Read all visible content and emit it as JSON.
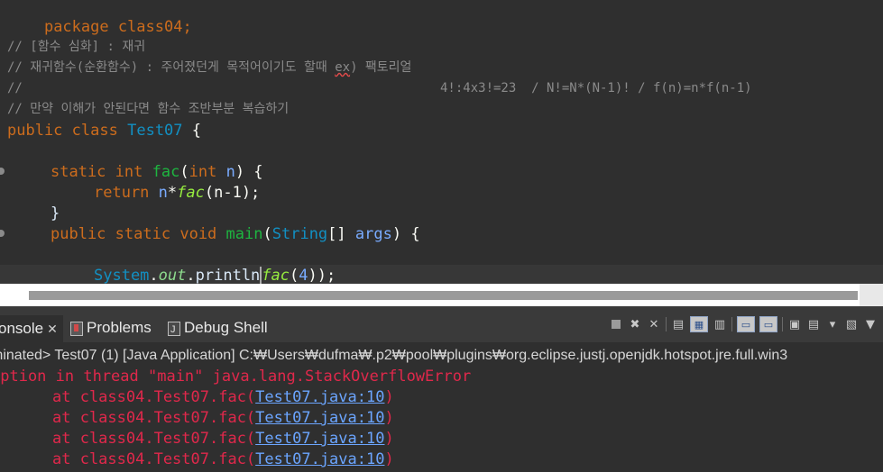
{
  "editor": {
    "line_package": "package class04;",
    "comment1": "// [함수 심화] : 재귀",
    "comment2_a": "// 재귀함수(순환함수) : 주어졌던게 목적어이기도 할때 ",
    "comment2_ex": "ex",
    "comment2_b": ") 팩토리얼",
    "comment3_a": "//",
    "comment3_b": "4!:4x3!=23  / N!=N*(N-1)! / f(n)=n*f(n-1)",
    "comment4": "// 만약 이해가 안된다면 함수 조반부분 복습하기",
    "class_decl": {
      "kw1": "public",
      "kw2": "class",
      "name": "Test07",
      "brace": " {"
    },
    "fac_decl": {
      "kw1": "static",
      "kw2": "int",
      "name": "fac",
      "open": "(",
      "ptype": "int",
      "pname": " n",
      "close": ") {"
    },
    "return_line": {
      "kw": "return",
      "var": " n",
      "op": "*",
      "call": "fac",
      "args": "(n-1);"
    },
    "close_brace": "}",
    "main_decl": {
      "kw1": "public",
      "kw2": "static",
      "kw3": "void",
      "name": "main",
      "open": "(",
      "ptype": "String",
      "arr": "[] ",
      "pname": "args",
      "close": ") {"
    },
    "print_line": {
      "cls": "System",
      "dot1": ".",
      "field": "out",
      "dot2": ".",
      "method": "println",
      "call": "fac",
      "open": "(",
      "num": "4",
      "close": "));"
    }
  },
  "tabs": {
    "console_label": "onsole",
    "console_close": "✕",
    "problems_label": "Problems",
    "debug_label": "Debug Shell"
  },
  "console": {
    "header": "minated> Test07 (1) [Java Application] C:₩Users₩dufma₩.p2₩pool₩plugins₩org.eclipse.justj.openjdk.hotspot.jre.full.win3",
    "exception": "eption in thread \"main\" java.lang.StackOverflowError",
    "trace_prefix": "at class04.Test07.fac(",
    "trace_link": "Test07.java:10",
    "trace_suffix": ")"
  },
  "colors": {
    "editor_bg": "#2f2f2f",
    "keyword": "#cc6c1d",
    "class_name": "#1290c3",
    "method_decl": "#1eb540",
    "error_text": "#e0284b",
    "link": "#6ba5ff"
  },
  "icons": [
    "problems-icon",
    "debug-shell-icon",
    "terminate-icon",
    "remove-launch-icon",
    "remove-all-icon",
    "scroll-lock-icon",
    "pin-console-icon",
    "display-selected-console-icon",
    "open-console-icon",
    "view-menu-icon"
  ]
}
